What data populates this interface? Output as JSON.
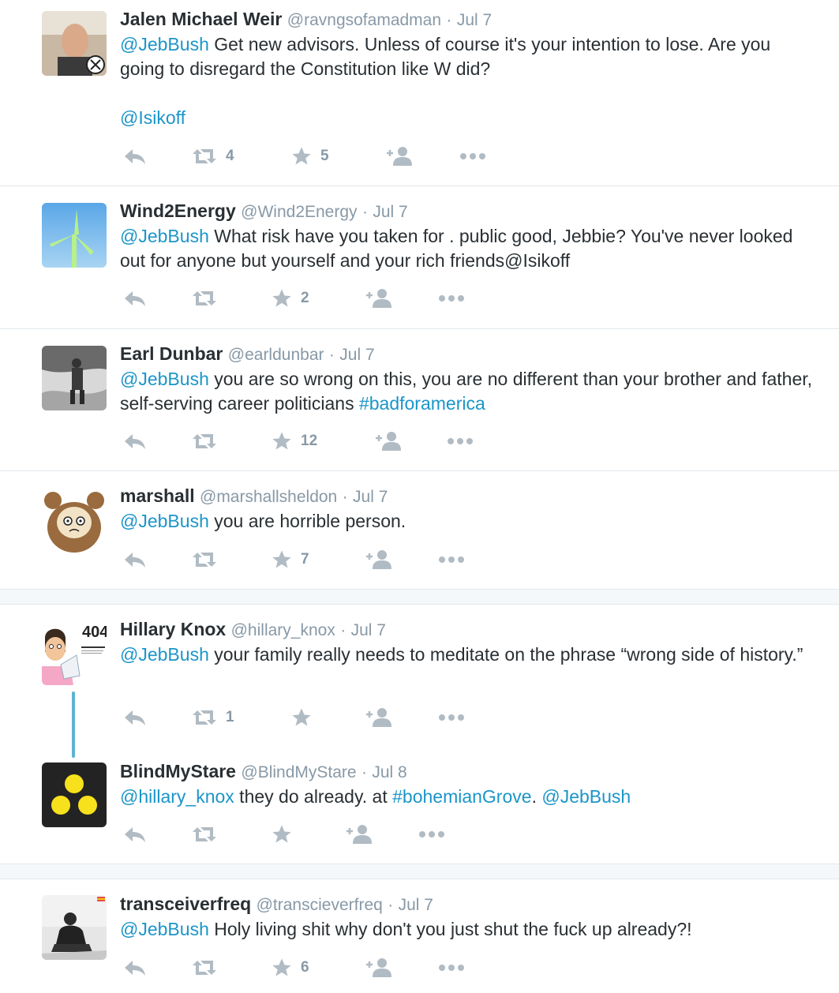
{
  "tweets": [
    {
      "name": "Jalen Michael Weir",
      "handle": "@ravngsofamadman",
      "date": "Jul 7",
      "mention": "@JebBush",
      "text1": " Get new advisors. Unless of course it's your intention to lose. Are you going to disregard the Constitution like W did?",
      "tail_mention": "@Isikoff",
      "retweets": "4",
      "favorites": "5"
    },
    {
      "name": "Wind2Energy",
      "handle": "@Wind2Energy",
      "date": "Jul 7",
      "mention": "@JebBush",
      "text1": " What risk have you taken for . public good, Jebbie? You've never looked out for anyone but yourself and your rich friends@Isikoff",
      "retweets": "",
      "favorites": "2"
    },
    {
      "name": "Earl Dunbar",
      "handle": "@earldunbar",
      "date": "Jul 7",
      "mention": "@JebBush",
      "text1": " you are so wrong on this, you are no different than your brother and father, self-serving career politicians ",
      "hashtag": "#badforamerica",
      "retweets": "",
      "favorites": "12"
    },
    {
      "name": "marshall",
      "handle": "@marshallsheldon",
      "date": "Jul 7",
      "mention": "@JebBush",
      "text1": " you are horrible person.",
      "retweets": "",
      "favorites": "7"
    },
    {
      "name": "Hillary Knox",
      "handle": "@hillary_knox",
      "date": "Jul 7",
      "mention": "@JebBush",
      "text1": " your family really needs to meditate on the phrase “wrong side of history.”",
      "avatar_text": "404",
      "retweets": "1",
      "favorites": ""
    },
    {
      "name": "BlindMyStare",
      "handle": "@BlindMyStare",
      "date": "Jul 8",
      "mention": "@hillary_knox",
      "text1": " they do already. at ",
      "hashtag": "#bohemianGrove",
      "text2": ". ",
      "mention2": "@JebBush",
      "retweets": "",
      "favorites": ""
    },
    {
      "name": "transceiverfreq",
      "handle": "@transcieverfreq",
      "date": "Jul 7",
      "mention": "@JebBush",
      "text1": " Holy living shit why don't you just shut the fuck up already?!",
      "retweets": "",
      "favorites": "6"
    }
  ],
  "separator_dot": "·",
  "icons": [
    "reply-icon",
    "retweet-icon",
    "favorite-icon",
    "follow-icon",
    "more-icon"
  ],
  "colors": {
    "link": "#1b95c9",
    "meta": "#8899a6",
    "action": "#b1bbc3",
    "thread": "#5eb3d2"
  }
}
